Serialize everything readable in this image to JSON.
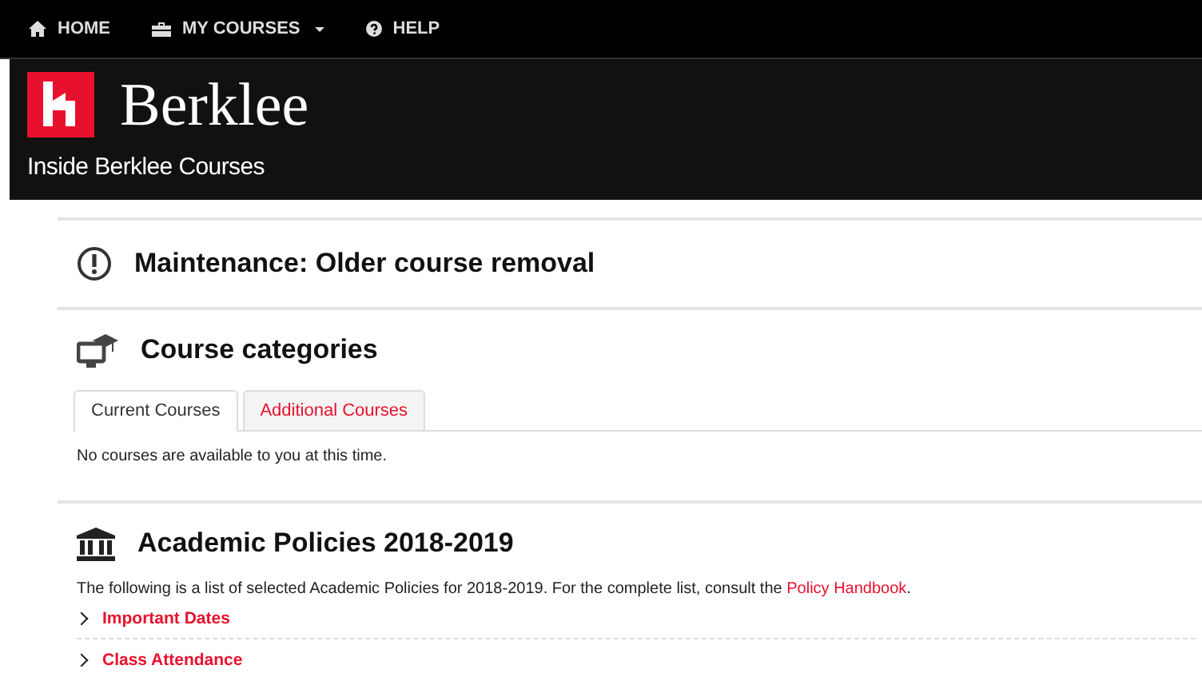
{
  "nav": [
    {
      "label": "HOME",
      "dropdown": false
    },
    {
      "label": "MY COURSES",
      "dropdown": true
    },
    {
      "label": "HELP",
      "dropdown": false
    }
  ],
  "header": {
    "brand": "Berklee",
    "subtitle": "Inside Berklee Courses"
  },
  "sections": [
    {
      "kind": "notice",
      "title": "Maintenance: Older course removal"
    },
    {
      "kind": "categories",
      "title": "Course categories",
      "tabs": [
        {
          "label": "Current Courses",
          "selected": true
        },
        {
          "label": "Additional Courses",
          "selected": false
        }
      ],
      "message": "No courses are available to you at this time."
    },
    {
      "kind": "policies",
      "title": "Academic Policies 2018-2019",
      "intro": "The following is a list of selected Academic Policies for 2018-2019. For the complete list, consult the ",
      "link": "Policy Handbook",
      "after": ".",
      "items": [
        {
          "label": "Important Dates",
          "expanded": false
        },
        {
          "label": "Class Attendance",
          "expanded": false
        }
      ]
    }
  ]
}
